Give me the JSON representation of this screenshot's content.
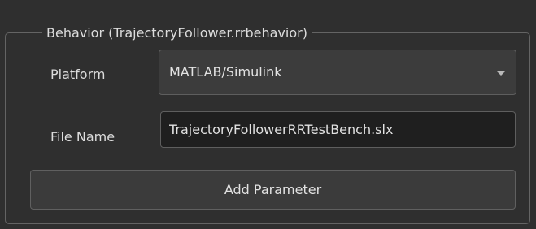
{
  "group": {
    "title": "Behavior (TrajectoryFollower.rrbehavior)"
  },
  "platform": {
    "label": "Platform",
    "selected": "MATLAB/Simulink",
    "icon": "chevron-down-icon"
  },
  "file_name": {
    "label": "File Name",
    "value": "TrajectoryFollowerRRTestBench.slx"
  },
  "add_parameter": {
    "label": "Add Parameter"
  },
  "colors": {
    "background": "#2f2f2f",
    "border": "#646464",
    "field_background": "#1f1f1f",
    "text": "#dcdcdc"
  }
}
